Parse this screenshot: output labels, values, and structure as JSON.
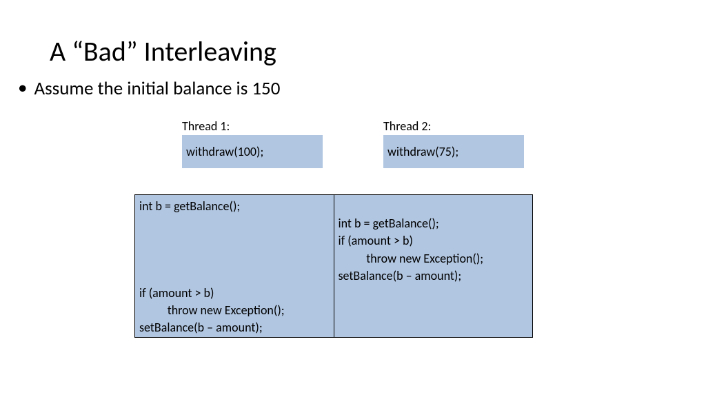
{
  "title": "A “Bad” Interleaving",
  "bullet": "Assume the initial balance is 150",
  "threads": {
    "t1_label": "Thread 1:",
    "t2_label": "Thread 2:",
    "t1_call": "withdraw(100);",
    "t2_call": "withdraw(75);"
  },
  "interleave": {
    "left": "int b = getBalance();\n\n\n\n\nif (amount > b)\n          throw new Exception();\nsetBalance(b – amount);",
    "right": "\nint b = getBalance();\nif (amount > b)\n          throw new Exception();\nsetBalance(b – amount);"
  }
}
